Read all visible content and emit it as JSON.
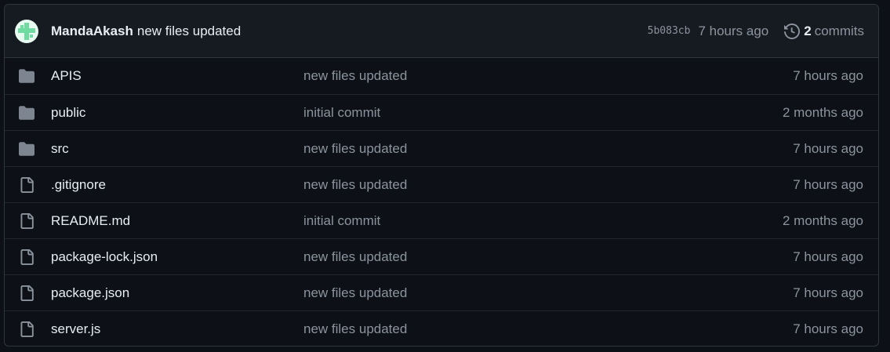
{
  "header": {
    "author": "MandaAkash",
    "message": "new files updated",
    "sha": "5b083cb",
    "time": "7 hours ago",
    "commit_count": "2",
    "commit_label": "commits"
  },
  "files": [
    {
      "name": "APIS",
      "type": "folder",
      "message": "new files updated",
      "time": "7 hours ago"
    },
    {
      "name": "public",
      "type": "folder",
      "message": "initial commit",
      "time": "2 months ago"
    },
    {
      "name": "src",
      "type": "folder",
      "message": "new files updated",
      "time": "7 hours ago"
    },
    {
      "name": ".gitignore",
      "type": "file",
      "message": "new files updated",
      "time": "7 hours ago"
    },
    {
      "name": "README.md",
      "type": "file",
      "message": "initial commit",
      "time": "2 months ago"
    },
    {
      "name": "package-lock.json",
      "type": "file",
      "message": "new files updated",
      "time": "7 hours ago"
    },
    {
      "name": "package.json",
      "type": "file",
      "message": "new files updated",
      "time": "7 hours ago"
    },
    {
      "name": "server.js",
      "type": "file",
      "message": "new files updated",
      "time": "7 hours ago"
    }
  ],
  "colors": {
    "background": "#0d1117",
    "header_bg": "#161b22",
    "border": "#30363d",
    "text": "#e6edf3",
    "muted": "#8b949e",
    "folder_icon": "#7d8590"
  }
}
